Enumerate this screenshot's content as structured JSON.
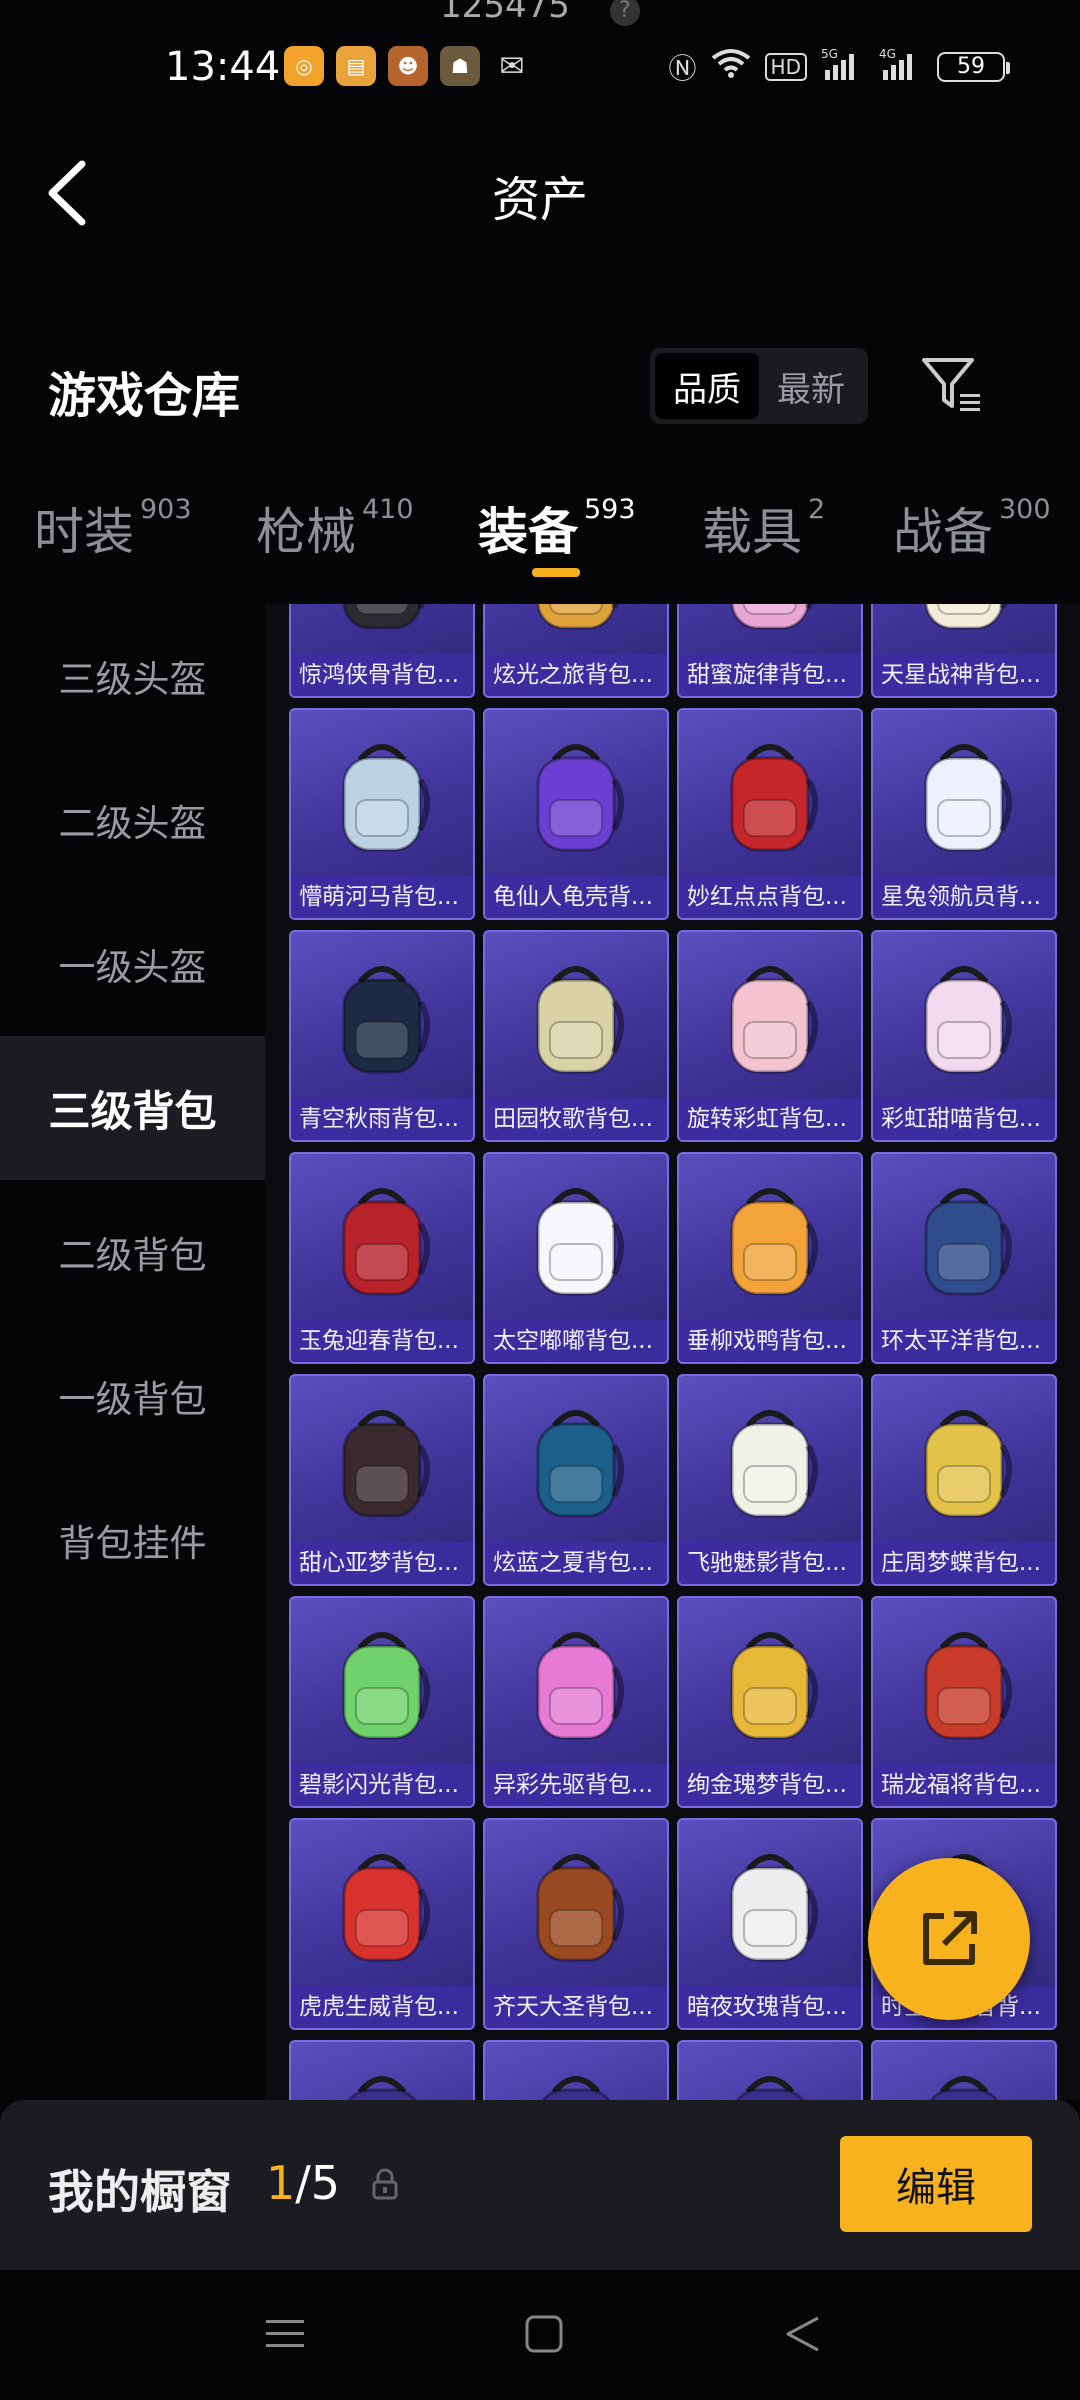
{
  "status": {
    "top_partial": "125475",
    "time": "13:44",
    "battery": "59"
  },
  "header": {
    "title": "资产"
  },
  "section": {
    "title": "游戏仓库",
    "sort_quality": "品质",
    "sort_newest": "最新"
  },
  "tabs": [
    {
      "label": "时装",
      "count": "903"
    },
    {
      "label": "枪械",
      "count": "410"
    },
    {
      "label": "装备",
      "count": "593"
    },
    {
      "label": "载具",
      "count": "2"
    },
    {
      "label": "战备",
      "count": "300"
    }
  ],
  "categories": [
    {
      "label": "三级头盔"
    },
    {
      "label": "二级头盔"
    },
    {
      "label": "一级头盔"
    },
    {
      "label": "三级背包"
    },
    {
      "label": "二级背包"
    },
    {
      "label": "一级背包"
    },
    {
      "label": "背包挂件"
    }
  ],
  "items": [
    {
      "name": "惊鸿侠骨背包...",
      "color": "#2b2b33"
    },
    {
      "name": "炫光之旅背包...",
      "color": "#e0a23a"
    },
    {
      "name": "甜蜜旋律背包...",
      "color": "#e8a6d6"
    },
    {
      "name": "天星战神背包...",
      "color": "#f2ecd8"
    },
    {
      "name": "懵萌河马背包...",
      "color": "#bcd3e6"
    },
    {
      "name": "龟仙人龟壳背...",
      "color": "#6a3fd1"
    },
    {
      "name": "妙红点点背包...",
      "color": "#c4262b"
    },
    {
      "name": "星兔领航员背...",
      "color": "#eef0ff"
    },
    {
      "name": "青空秋雨背包...",
      "color": "#1e2a44"
    },
    {
      "name": "田园牧歌背包...",
      "color": "#d9d2a6"
    },
    {
      "name": "旋转彩虹背包...",
      "color": "#f3c3d0"
    },
    {
      "name": "彩虹甜喵背包...",
      "color": "#f1d9ee"
    },
    {
      "name": "玉兔迎春背包...",
      "color": "#b8222a"
    },
    {
      "name": "太空嘟嘟背包...",
      "color": "#f6f6fb"
    },
    {
      "name": "垂柳戏鸭背包...",
      "color": "#f2a43a"
    },
    {
      "name": "环太平洋背包...",
      "color": "#2f4d8c"
    },
    {
      "name": "甜心亚梦背包...",
      "color": "#3a2a30"
    },
    {
      "name": "炫蓝之夏背包...",
      "color": "#1c5f8a"
    },
    {
      "name": "飞驰魅影背包...",
      "color": "#f2f1e8"
    },
    {
      "name": "庄周梦蝶背包...",
      "color": "#e3c24a"
    },
    {
      "name": "碧影闪光背包...",
      "color": "#6fd26a"
    },
    {
      "name": "异彩先驱背包...",
      "color": "#e67ad4"
    },
    {
      "name": "绚金瑰梦背包...",
      "color": "#e8b83a"
    },
    {
      "name": "瑞龙福将背包...",
      "color": "#c83b2a"
    },
    {
      "name": "虎虎生威背包...",
      "color": "#d8322e"
    },
    {
      "name": "齐天大圣背包...",
      "color": "#9a4a22"
    },
    {
      "name": "暗夜玫瑰背包...",
      "color": "#eeeeee"
    },
    {
      "name": "时空追击者背...",
      "color": "#5a5a7a"
    },
    {
      "name": "",
      "color": "#3a2f8a"
    },
    {
      "name": "",
      "color": "#3a2f8a"
    },
    {
      "name": "",
      "color": "#3a2f8a"
    },
    {
      "name": "",
      "color": "#3a2f8a"
    }
  ],
  "showcase": {
    "title": "我的橱窗",
    "current": "1",
    "sep_total": "/5",
    "edit_label": "编辑"
  },
  "colors": {
    "accent": "#f7b21e",
    "card": "#3e3296"
  }
}
